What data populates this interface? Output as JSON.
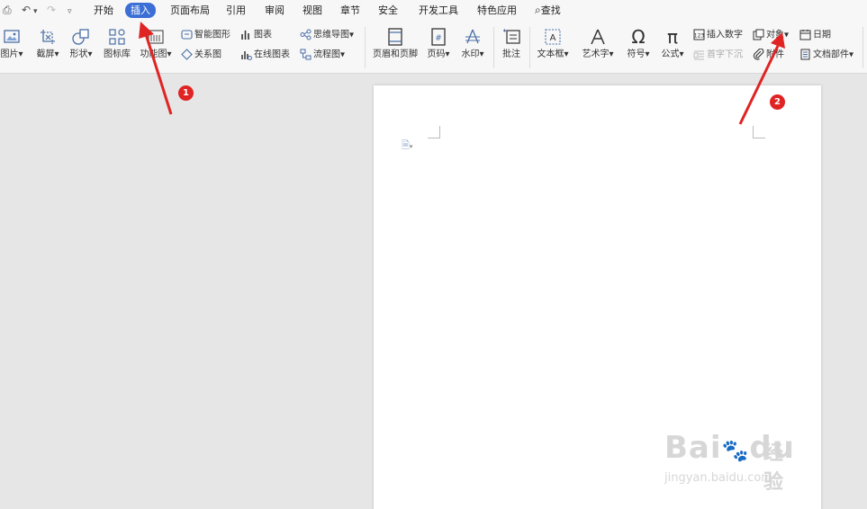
{
  "menu": {
    "items": [
      "开始",
      "插入",
      "页面布局",
      "引用",
      "审阅",
      "视图",
      "章节",
      "安全",
      "开发工具",
      "特色应用"
    ],
    "active": "插入",
    "search_label": "查找"
  },
  "ribbon": {
    "picture": "图片",
    "screenshot": "截屏",
    "shape": "形状",
    "icon_lib": "图标库",
    "func_chart": "功能图",
    "smart_art": "智能图形",
    "chart": "图表",
    "mind_map": "思维导图",
    "relation": "关系图",
    "online_chart": "在线图表",
    "flowchart": "流程图",
    "header_footer": "页眉和页脚",
    "page_number": "页码",
    "watermark": "水印",
    "comment": "批注",
    "textbox": "文本框",
    "wordart": "艺术字",
    "symbol": "符号",
    "formula": "公式",
    "insert_number": "插入数字",
    "drop_cap": "首字下沉",
    "object": "对象",
    "attachment": "附件",
    "date": "日期",
    "doc_parts": "文档部件"
  },
  "annotations": {
    "badge1": "1",
    "badge2": "2"
  },
  "watermark": {
    "brand": "Bai",
    "brand2": "du",
    "cn": "经验",
    "url": "jingyan.baidu.com"
  },
  "colors": {
    "active_tab": "#3c6fd6",
    "arrow": "#e02424",
    "badge": "#e02424"
  }
}
